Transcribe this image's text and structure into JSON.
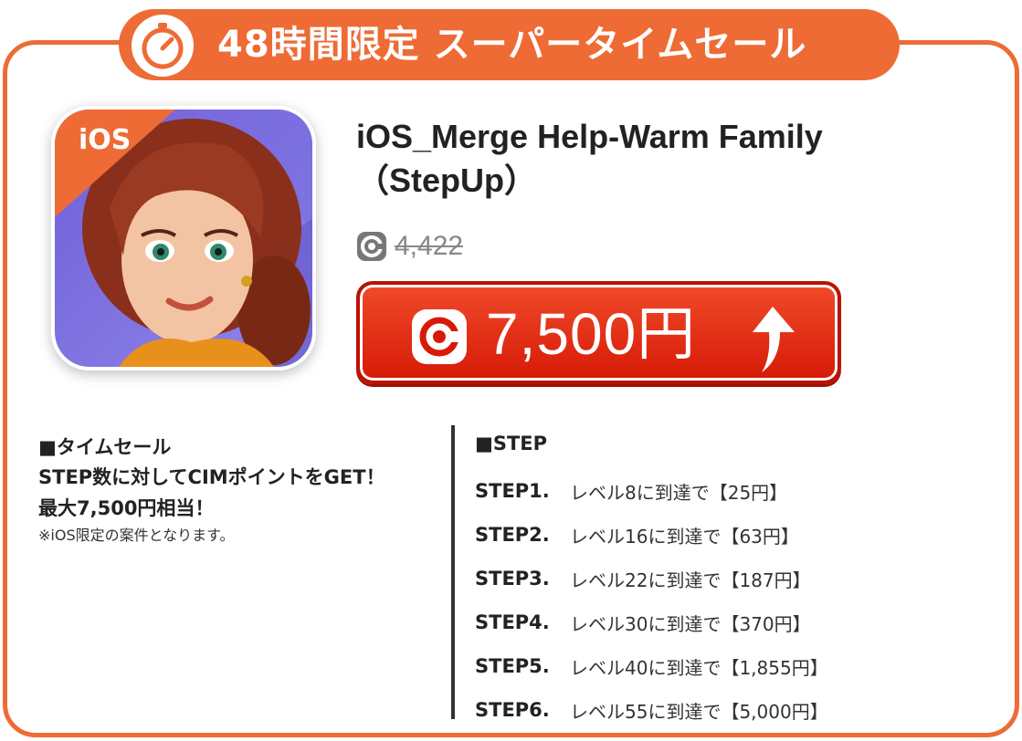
{
  "banner": {
    "title": "48時間限定 スーパータイムセール",
    "icon": "stopwatch-icon"
  },
  "app": {
    "name_line1": "iOS_Merge Help-Warm Family",
    "name_line2": "（StepUp）",
    "platform_badge": "iOS"
  },
  "price": {
    "old": "4,422",
    "current": "7,500円",
    "coin_icon": "cim-coin-icon",
    "trend_icon": "arrow-up-icon"
  },
  "time_sale": {
    "heading": "■タイムセール",
    "line1": "STEP数に対してCIMポイントをGET！",
    "line2": "最大7,500円相当！",
    "note": "※iOS限定の案件となります。"
  },
  "steps": {
    "heading": "■STEP",
    "items": [
      {
        "label": "STEP1.",
        "desc": "レベル8に到達で【25円】"
      },
      {
        "label": "STEP2.",
        "desc": "レベル16に到達で【63円】"
      },
      {
        "label": "STEP3.",
        "desc": "レベル22に到達で【187円】"
      },
      {
        "label": "STEP4.",
        "desc": "レベル30に到達で【370円】"
      },
      {
        "label": "STEP5.",
        "desc": "レベル40に到達で【1,855円】"
      },
      {
        "label": "STEP6.",
        "desc": "レベル55に到達で【5,000円】"
      }
    ]
  },
  "colors": {
    "accent": "#ee6b35",
    "button": "#d61a06"
  }
}
